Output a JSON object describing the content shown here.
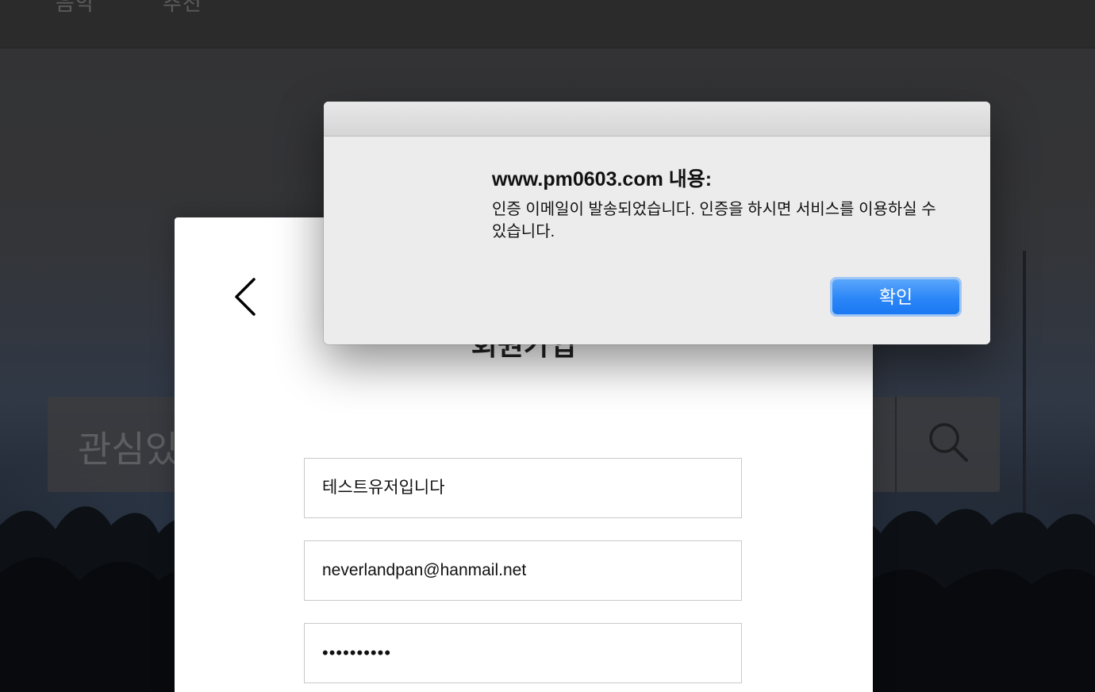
{
  "top_nav": {
    "items": [
      "음악",
      "추천"
    ]
  },
  "search": {
    "placeholder": "관심있"
  },
  "signup": {
    "title": "회원가입",
    "name_value": "테스트유저입니다",
    "email_value": "neverlandpan@hanmail.net",
    "password_value": "••••••••••"
  },
  "dialog": {
    "heading": "www.pm0603.com 내용:",
    "message": "인증 이메일이 발송되었습니다. 인증을 하시면 서비스를 이용하실 수 있습니다.",
    "ok_label": "확인"
  },
  "colors": {
    "accent": "#2b86f7",
    "dialog_bg": "#ececec",
    "page_bg": "#2f2f31"
  },
  "icons": [
    "chevron-left-icon",
    "search-icon"
  ]
}
